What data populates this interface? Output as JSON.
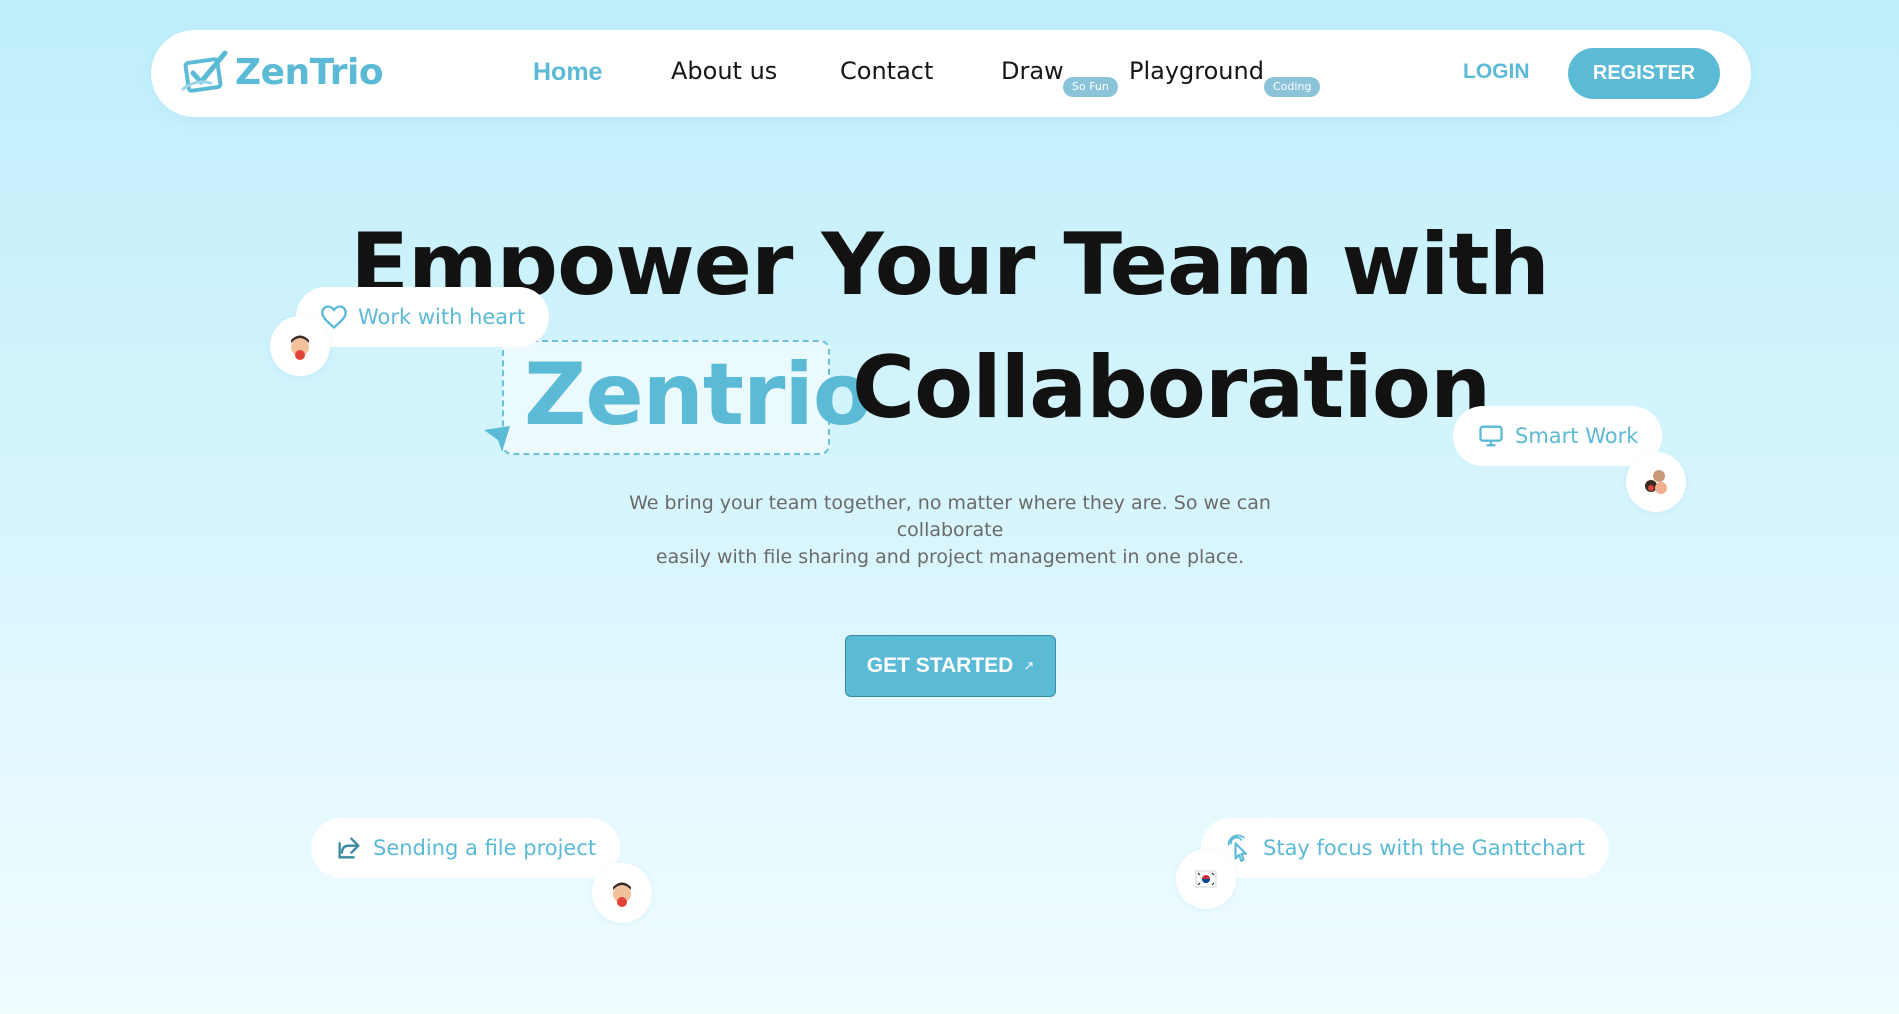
{
  "brand": {
    "name": "ZenTrio",
    "color": "#5bbad6"
  },
  "nav": {
    "links": [
      {
        "label": "Home",
        "active": true
      },
      {
        "label": "About us"
      },
      {
        "label": "Contact"
      },
      {
        "label": "Draw",
        "badge": "So Fun"
      },
      {
        "label": "Playground",
        "badge": "Coding"
      }
    ],
    "login_label": "LOGIN",
    "register_label": "REGISTER"
  },
  "hero": {
    "line1": "Empower Your Team with",
    "brand_word": "Zentrio",
    "line2_rest": "Collaboration",
    "subtitle_line1": "We bring your team together, no matter where they are. So we can collaborate",
    "subtitle_line2": "easily with file sharing and project management in one place.",
    "cta_label": "GET STARTED",
    "cta_icon": "arrow-up-right-icon"
  },
  "chips": {
    "work_with_heart": {
      "label": "Work with heart",
      "icon": "heart-icon"
    },
    "smart_work": {
      "label": "Smart Work",
      "icon": "monitor-icon"
    },
    "sending_file": {
      "label": "Sending a file project",
      "icon": "share-icon"
    },
    "stay_focus": {
      "label": "Stay focus with the Ganttchart",
      "icon": "pointer-click-icon"
    }
  },
  "colors": {
    "accent": "#5bbad6",
    "text_dark": "#121212",
    "bg_top": "#bfeefb",
    "bg_bottom": "#f1fcff"
  }
}
